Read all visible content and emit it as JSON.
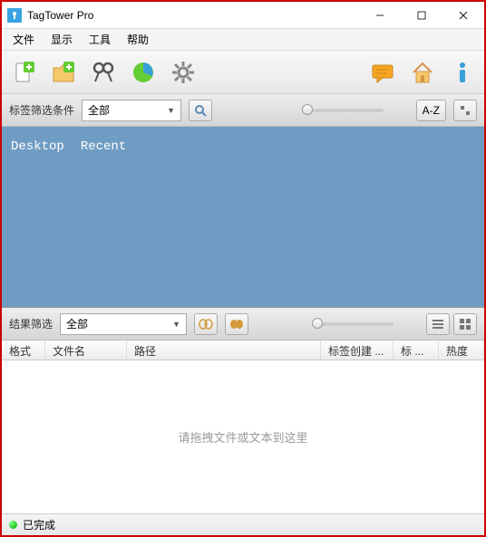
{
  "window": {
    "title": "TagTower Pro"
  },
  "menu": {
    "file": "文件",
    "view": "显示",
    "tools": "工具",
    "help": "帮助"
  },
  "tagfilter": {
    "label": "标签筛选条件",
    "value": "全部",
    "az": "A-Z"
  },
  "tags": {
    "t0": "Desktop",
    "t1": "Recent"
  },
  "resultfilter": {
    "label": "结果筛选",
    "value": "全部"
  },
  "columns": {
    "c0": "格式",
    "c1": "文件名",
    "c2": "路径",
    "c3": "标签创建 ...",
    "c4": "标 ...",
    "c5": "热度"
  },
  "empty": {
    "text": "请拖拽文件或文本到这里"
  },
  "status": {
    "text": "已完成"
  }
}
